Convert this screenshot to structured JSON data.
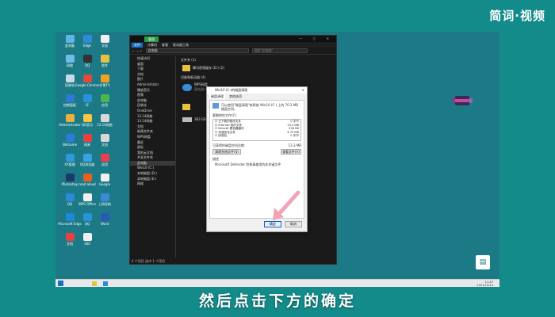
{
  "brand": "简词·视频",
  "subtitle": "然后点击下方的确定",
  "colors": {
    "accent": "#1a6fc4",
    "desktop": "#1c7a86",
    "outer": "#138b8a",
    "explorer_bg": "#1a1a1a",
    "tab_green": "#2b9b4a",
    "arrow": "#f3a3b5"
  },
  "desktop": {
    "icons": [
      {
        "label": "此电脑",
        "color": "#5fb5e6"
      },
      {
        "label": "Edge",
        "color": "#2e8dd8"
      },
      {
        "label": "文档",
        "color": "#f0f0f0"
      },
      {
        "label": "网络",
        "color": "#6fbce8"
      },
      {
        "label": "QQ",
        "color": "#333333"
      },
      {
        "label": "软件",
        "color": "#e8c040"
      },
      {
        "label": "回收站",
        "color": "#c8d8e8"
      },
      {
        "label": "Google Chrome",
        "color": "#e04a3a"
      },
      {
        "label": "芒果TV",
        "color": "#f2a020"
      },
      {
        "label": "控制面板",
        "color": "#2d7ad6"
      },
      {
        "label": "IE",
        "color": "#2a92d8"
      },
      {
        "label": "应用",
        "color": "#49b850"
      },
      {
        "label": "Administrator",
        "color": "#e8b040"
      },
      {
        "label": "QQ音乐",
        "color": "#f5c842"
      },
      {
        "label": "13.14网络",
        "color": "#d8d8d8"
      },
      {
        "label": "WeGame",
        "color": "#2a7ad8"
      },
      {
        "label": "网易",
        "color": "#e84040"
      },
      {
        "label": "文档",
        "color": "#d8d8d8"
      },
      {
        "label": "XX管理",
        "color": "#2a9ad8"
      },
      {
        "label": "QQ浏览器",
        "color": "#3aa0e0"
      },
      {
        "label": "应用",
        "color": "#e84050"
      },
      {
        "label": "Photoshop",
        "color": "#1a3a6a"
      },
      {
        "label": "read aloud",
        "color": "#e86020"
      },
      {
        "label": "Google",
        "color": "#f0f0f0"
      },
      {
        "label": "QQ",
        "color": "#2a8ad8"
      },
      {
        "label": "WPS Office",
        "color": "#f0f0f0"
      },
      {
        "label": "上网导航",
        "color": "#3a8ad8"
      },
      {
        "label": "Microsoft Edge",
        "color": "#1a8ad8"
      },
      {
        "label": "QQ",
        "color": "#2a92d8"
      },
      {
        "label": "Word",
        "color": "#2a5ab8"
      },
      {
        "label": "文档",
        "color": "#e84040"
      },
      {
        "label": "360",
        "color": "#f0f0f0"
      }
    ]
  },
  "explorer": {
    "tab_badge": "管理",
    "ribbon": [
      "文件",
      "计算机",
      "查看",
      "驱动器工具"
    ],
    "address": "此电脑",
    "search_placeholder": "搜索\"此电脑\"",
    "nav_items": [
      "快速访问",
      "桌面",
      "下载",
      "文档",
      "图片",
      "Administrator",
      "播放音乐",
      "视频",
      "此电脑",
      "回收站",
      "OneDrive",
      "13.14网络",
      "13.14网络",
      "文档",
      "新建文件夹",
      "WPS网盘",
      "最近",
      "星标",
      "我的云文档",
      "共享文件夹",
      "此电脑",
      "Win10 (C:)",
      "本地磁盘 (D:)",
      "本地磁盘 (E:)",
      "网络"
    ],
    "section_folders": "文件夹 (1)",
    "folder_item": "腾讯视频缓存 (D:) (2)",
    "section_devices": "设备和驱动器 (4)",
    "wps_label": "WPS网盘",
    "wps_sub": "双击进入WPS网盘",
    "disk_label": "383 GB 可用",
    "status": "4 个项目  选中 1 个项目"
  },
  "dialog": {
    "title": "Win10 (C:)的磁盘清理",
    "tabs": [
      "磁盘清理",
      "其他选项"
    ],
    "intro": "可以使用\"磁盘清理\"来释放 Win10 (C:) 上的 70.2 MB 磁盘空间。",
    "list_header": "要删除的文件(F):",
    "rows": [
      {
        "name": "已下载的程序文件",
        "size": "0 字节"
      },
      {
        "name": "Internet 临时文件",
        "size": "13.3 MB"
      },
      {
        "name": "DirectX 着色器缓存",
        "size": "334 KB"
      },
      {
        "name": "传递优化文件",
        "size": "4.73 MB"
      },
      {
        "name": "回收站",
        "size": "0 字节"
      }
    ],
    "total_label": "可获得的磁盘空间总数:",
    "total_value": "13.3 MB",
    "clean_system_btn": "清理系统文件(S)",
    "view_files_btn": "查看文件(V)",
    "desc_header": "描述",
    "desc_text": "Microsoft Defender 防病毒使用的非关键文件",
    "ok_label": "确定",
    "cancel_label": "取消"
  },
  "taskbar": {
    "time": "11:47",
    "date": "2021/10/14"
  }
}
